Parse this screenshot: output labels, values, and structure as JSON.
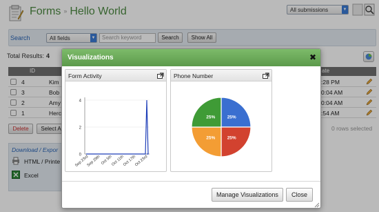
{
  "header": {
    "app_title": "Forms",
    "separator": "»",
    "form_name": "Hello World",
    "submissions_filter": "All submissions"
  },
  "search": {
    "label": "Search",
    "field_value": "All fields",
    "keyword_placeholder": "Search keyword",
    "search_button": "Search",
    "show_all_button": "Show All"
  },
  "results": {
    "label": "Total Results:",
    "count": "4"
  },
  "table": {
    "columns": [
      "ID",
      "ate"
    ],
    "rows": [
      {
        "id": "4",
        "name": "Kim",
        "date": ":28 PM"
      },
      {
        "id": "3",
        "name": "Bob",
        "date": "0:04 AM"
      },
      {
        "id": "2",
        "name": "Amy",
        "date": "0:04 AM"
      },
      {
        "id": "1",
        "name": "Herc",
        "date": ":54 AM"
      }
    ]
  },
  "actions": {
    "delete_button": "Delete",
    "select_all_button": "Select A",
    "rows_selected": "0 rows selected"
  },
  "download": {
    "title": "Download / Expor",
    "items": [
      "HTML / Printe",
      "Excel"
    ]
  },
  "modal": {
    "title": "Visualizations",
    "close_symbol": "✖",
    "manage_button": "Manage Visualizations",
    "close_button": "Close"
  },
  "colors": {
    "brand_green": "#4d8a43",
    "link_blue": "#2a64b5",
    "modal_header": "#6aa958",
    "line_series": "#1f3fb8"
  },
  "chart_data": [
    {
      "type": "line",
      "title": "Form Activity",
      "x": [
        "Sep 23rd",
        "Sep 29th",
        "Oct 5th",
        "Oct 11th",
        "Oct 17th",
        "Oct 23rd"
      ],
      "y_ticks": [
        0,
        2,
        4
      ],
      "ylim": [
        0,
        4
      ],
      "series": [
        {
          "values": [
            0,
            0,
            0,
            0,
            0,
            4
          ]
        }
      ]
    },
    {
      "type": "pie",
      "title": "Phone Number",
      "slices": [
        {
          "label": "25%",
          "value": 25,
          "color": "#3a6fd0"
        },
        {
          "label": "25%",
          "value": 25,
          "color": "#d2422f"
        },
        {
          "label": "25%",
          "value": 25,
          "color": "#f39d34"
        },
        {
          "label": "25%",
          "value": 25,
          "color": "#3f9b36"
        }
      ]
    }
  ]
}
